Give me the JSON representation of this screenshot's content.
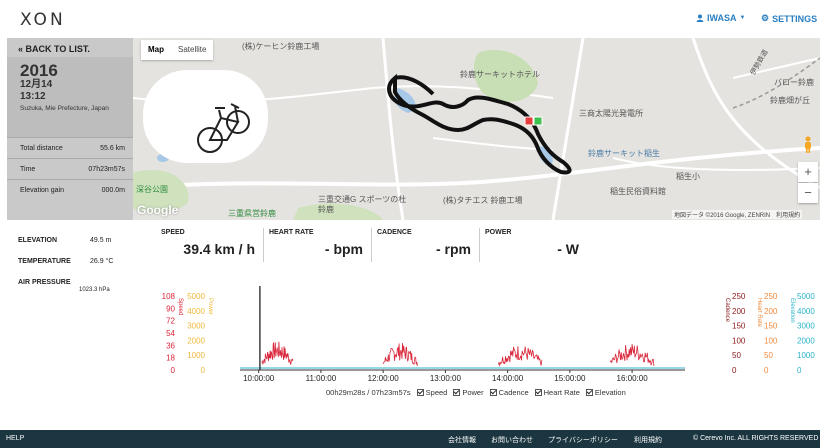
{
  "header": {
    "logo": "XON",
    "user_label": "IWASA",
    "settings_label": "SETTINGS",
    "accent_color": "#2a7fc1"
  },
  "sidebar": {
    "back_label": "BACK TO LIST.",
    "year": "2016",
    "date": "12月14",
    "time": "13:12",
    "location": "Suzuka, Mie Prefecture, Japan",
    "stats": [
      {
        "label": "Total distance",
        "value": "55.6 km"
      },
      {
        "label": "Time",
        "value": "07h23m57s"
      },
      {
        "label": "Elevation gain",
        "value": "000.0m"
      }
    ]
  },
  "map": {
    "tabs": [
      {
        "label": "Map",
        "active": true
      },
      {
        "label": "Satellite",
        "active": false
      }
    ],
    "labels": [
      {
        "text": "(株)ケーヒン鈴鹿工場"
      },
      {
        "text": "鈴鹿サーキットホテル"
      },
      {
        "text": "三商太陽光発電所"
      },
      {
        "text": "鈴鹿サーキット稲生"
      },
      {
        "text": "稲生小"
      },
      {
        "text": "稲生民俗資料館"
      },
      {
        "text": "深谷公園"
      },
      {
        "text": "三重交通G スポーツの杜 鈴鹿"
      },
      {
        "text": "(株)タチエス 鈴鹿工場"
      },
      {
        "text": "三重県営鈴鹿"
      },
      {
        "text": "バロー鈴鹿"
      },
      {
        "text": "鈴鹿畑が丘"
      },
      {
        "text": "伊勢鉄道"
      }
    ],
    "copyright": "地図データ ©2016 Google, ZENRIN　利用規約",
    "google": "Google",
    "zoom_in": "+",
    "zoom_out": "−"
  },
  "metrics": {
    "elevation": {
      "label": "ELEVATION",
      "value": "49.5 m"
    },
    "temperature": {
      "label": "TEMPERATURE",
      "value": "26.9 °C"
    },
    "pressure": {
      "label": "AIR PRESSURE",
      "value": "1023.3 hPa"
    }
  },
  "live": [
    {
      "label": "SPEED",
      "value": "39.4 km / h"
    },
    {
      "label": "HEART RATE",
      "value": "- bpm"
    },
    {
      "label": "CADENCE",
      "value": "- rpm"
    },
    {
      "label": "POWER",
      "value": "- W"
    }
  ],
  "chart_data": {
    "type": "line",
    "x_ticks": [
      "10:00:00",
      "11:00:00",
      "12:00:00",
      "13:00:00",
      "14:00:00",
      "15:00:00",
      "16:00:00"
    ],
    "left_axes": [
      {
        "name": "Speed",
        "color": "#d9263a",
        "ticks": [
          "108",
          "90",
          "72",
          "54",
          "36",
          "18",
          "0"
        ]
      },
      {
        "name": "Power",
        "color": "#f0b93b",
        "ticks": [
          "5000",
          "4000",
          "3000",
          "2000",
          "1000",
          "0"
        ]
      }
    ],
    "right_axes": [
      {
        "name": "Cadence",
        "color": "#8b1a1a",
        "ticks": [
          "250",
          "200",
          "150",
          "100",
          "50",
          "0"
        ]
      },
      {
        "name": "Heart Rate",
        "color": "#f08a3c",
        "ticks": [
          "250",
          "200",
          "150",
          "100",
          "50",
          "0"
        ]
      },
      {
        "name": "Elevation",
        "color": "#2ab3c9",
        "ticks": [
          "5000",
          "4000",
          "3000",
          "2000",
          "1000",
          "0"
        ]
      }
    ],
    "speed_bursts": [
      {
        "start": 10.05,
        "end": 10.55,
        "peak": 42
      },
      {
        "start": 12.0,
        "end": 12.55,
        "peak": 40
      },
      {
        "start": 13.85,
        "end": 14.55,
        "peak": 38
      },
      {
        "start": 15.65,
        "end": 16.35,
        "peak": 40
      }
    ],
    "cursor_x": 10.02
  },
  "playback": {
    "position": "00h29m28s / 07h23m57s",
    "toggles": [
      {
        "label": "Speed",
        "checked": true
      },
      {
        "label": "Power",
        "checked": true
      },
      {
        "label": "Cadence",
        "checked": true
      },
      {
        "label": "Heart Rate",
        "checked": true
      },
      {
        "label": "Elevation",
        "checked": true
      }
    ]
  },
  "footer": {
    "help": "HELP",
    "links": [
      "会社情報",
      "お問い合わせ",
      "プライバシーポリシー",
      "利用規約"
    ],
    "copyright": "© Cerevo Inc. ALL RIGHTS RESERVED"
  }
}
